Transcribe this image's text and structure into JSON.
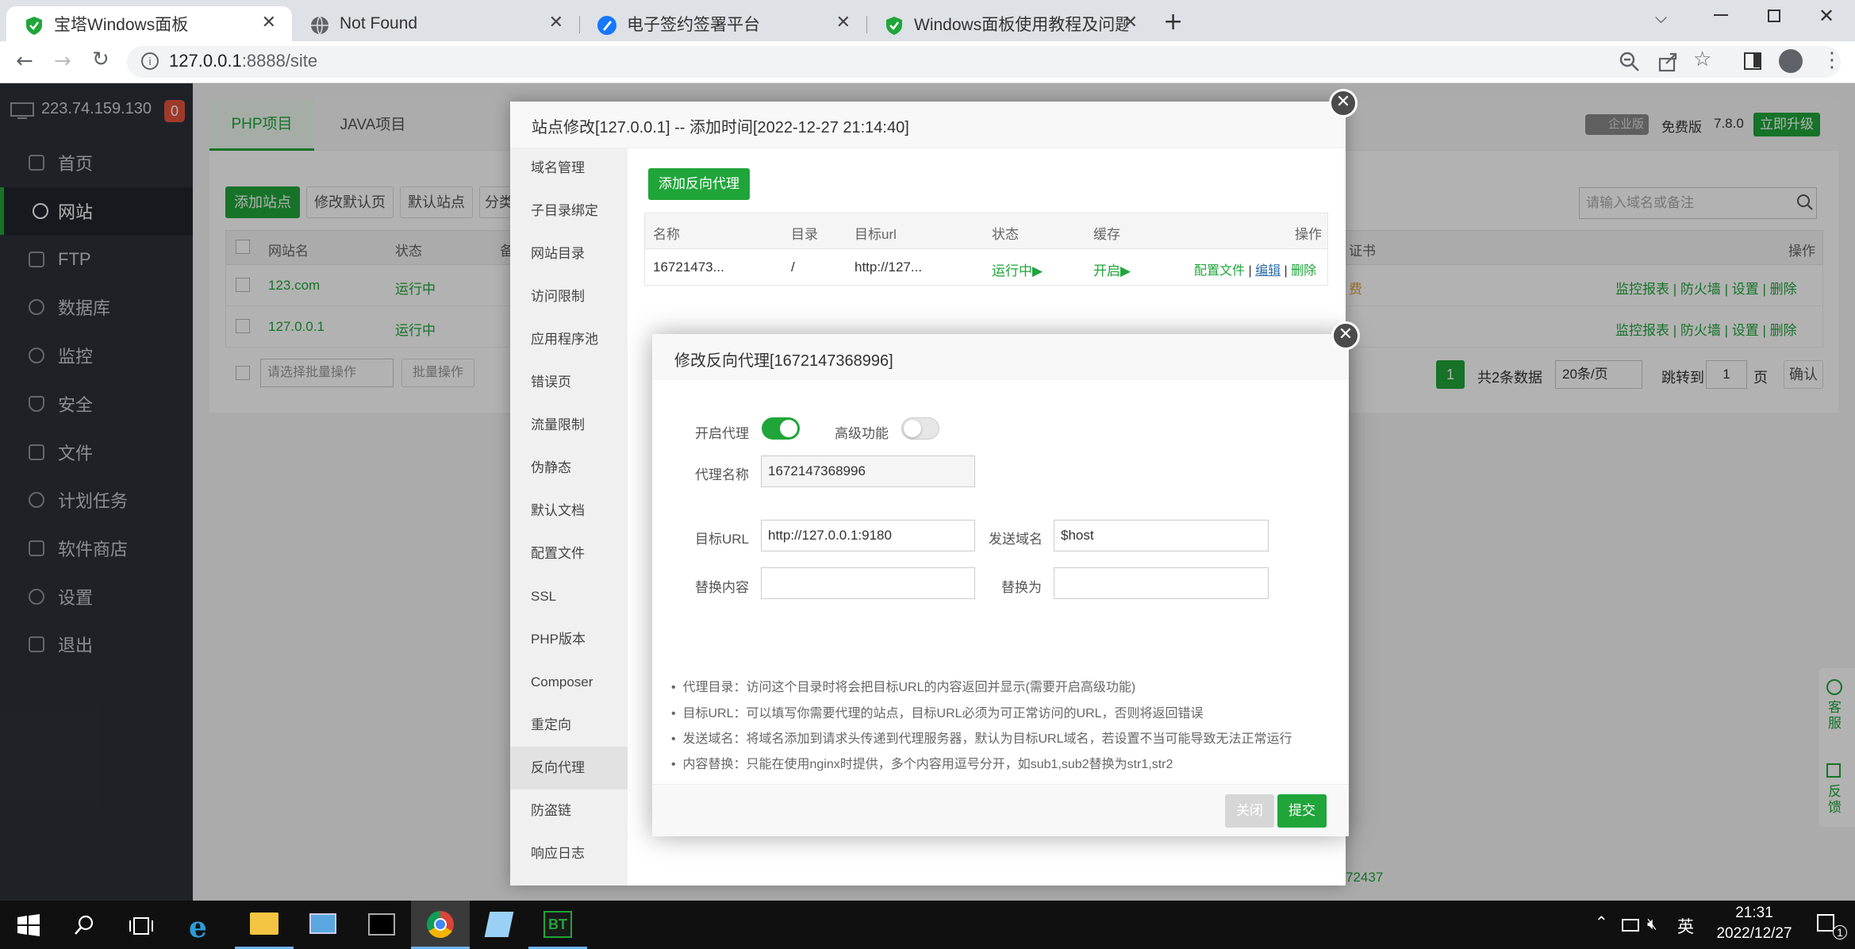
{
  "browser": {
    "tabs": [
      {
        "title": "宝塔Windows面板",
        "active": true
      },
      {
        "title": "Not Found",
        "active": false
      },
      {
        "title": "电子签约签署平台",
        "active": false
      },
      {
        "title": "Windows面板使用教程及问题汇",
        "active": false
      }
    ],
    "url_host": "127.0.0.1",
    "url_rest": ":8888/site"
  },
  "sidebar": {
    "ip": "223.74.159.130",
    "badge": "0",
    "items": [
      {
        "label": "首页",
        "icon": "home-icon"
      },
      {
        "label": "网站",
        "icon": "globe-icon",
        "active": true
      },
      {
        "label": "FTP",
        "icon": "ftp-icon"
      },
      {
        "label": "数据库",
        "icon": "database-icon"
      },
      {
        "label": "监控",
        "icon": "monitor-icon"
      },
      {
        "label": "安全",
        "icon": "shield-icon"
      },
      {
        "label": "文件",
        "icon": "folder-icon"
      },
      {
        "label": "计划任务",
        "icon": "clock-icon"
      },
      {
        "label": "软件商店",
        "icon": "grid-icon"
      },
      {
        "label": "设置",
        "icon": "gear-icon"
      },
      {
        "label": "退出",
        "icon": "exit-icon"
      }
    ]
  },
  "site": {
    "tabs": [
      "PHP项目",
      "JAVA项目"
    ],
    "edition_badge": "企业版",
    "free_label": "免费版",
    "version": "7.8.0",
    "upgrade": "立即升级",
    "buttons": [
      "添加站点",
      "修改默认页",
      "默认站点",
      "分类"
    ],
    "search_placeholder": "请输入域名或备注",
    "columns": {
      "name": "网站名",
      "status": "状态",
      "remark": "备",
      "ssl": "证书",
      "actions": "操作"
    },
    "rows": [
      {
        "name": "123.com",
        "status": "运行中",
        "ssl": "费"
      },
      {
        "name": "127.0.0.1",
        "status": "运行中",
        "ssl": ""
      }
    ],
    "row_actions": [
      "监控报表",
      "防火墙",
      "设置",
      "删除"
    ],
    "batch_placeholder": "请选择批量操作",
    "batch_btn": "批量操作",
    "pagination": {
      "page": "1",
      "total": "共2条数据",
      "per_page": "20条/页",
      "jump": "跳转到",
      "page_input": "1",
      "page_unit": "页",
      "confirm": "确认"
    },
    "footer_fragment": "72437"
  },
  "modal1": {
    "title": "站点修改[127.0.0.1] -- 添加时间[2022-12-27 21:14:40]",
    "nav": [
      "域名管理",
      "子目录绑定",
      "网站目录",
      "访问限制",
      "应用程序池",
      "错误页",
      "流量限制",
      "伪静态",
      "默认文档",
      "配置文件",
      "SSL",
      "PHP版本",
      "Composer",
      "重定向",
      "反向代理",
      "防盗链",
      "响应日志"
    ],
    "active_nav": "反向代理",
    "add_btn": "添加反向代理",
    "columns": {
      "name": "名称",
      "dir": "目录",
      "url": "目标url",
      "status": "状态",
      "cache": "缓存",
      "ops": "操作"
    },
    "row": {
      "name": "16721473...",
      "dir": "/",
      "url": "http://127...",
      "status": "运行中▶",
      "cache": "开启▶",
      "op1": "配置文件",
      "op2": "编辑",
      "op3": "删除"
    }
  },
  "modal2": {
    "title": "修改反向代理[1672147368996]",
    "enable_label": "开启代理",
    "advanced_label": "高级功能",
    "name_label": "代理名称",
    "name_value": "1672147368996",
    "url_label": "目标URL",
    "url_value": "http://127.0.0.1:9180",
    "send_label": "发送域名",
    "send_value": "$host",
    "replace_label": "替换内容",
    "replace_to_label": "替换为",
    "tips": [
      "代理目录：访问这个目录时将会把目标URL的内容返回并显示(需要开启高级功能)",
      "目标URL：可以填写你需要代理的站点，目标URL必须为可正常访问的URL，否则将返回错误",
      "发送域名：将域名添加到请求头传递到代理服务器，默认为目标URL域名，若设置不当可能导致无法正常运行",
      "内容替换：只能在使用nginx时提供，多个内容用逗号分开，如sub1,sub2替换为str1,str2"
    ],
    "close_btn": "关闭",
    "submit_btn": "提交",
    "proxy_enabled": true,
    "advanced_enabled": false
  },
  "float": {
    "service": "客服",
    "feedback": "反馈"
  },
  "taskbar": {
    "ime": "英",
    "time": "21:31",
    "date": "2022/12/27",
    "notif": "1"
  },
  "colors": {
    "accent": "#20a53a",
    "sidebar": "#2c3138"
  }
}
